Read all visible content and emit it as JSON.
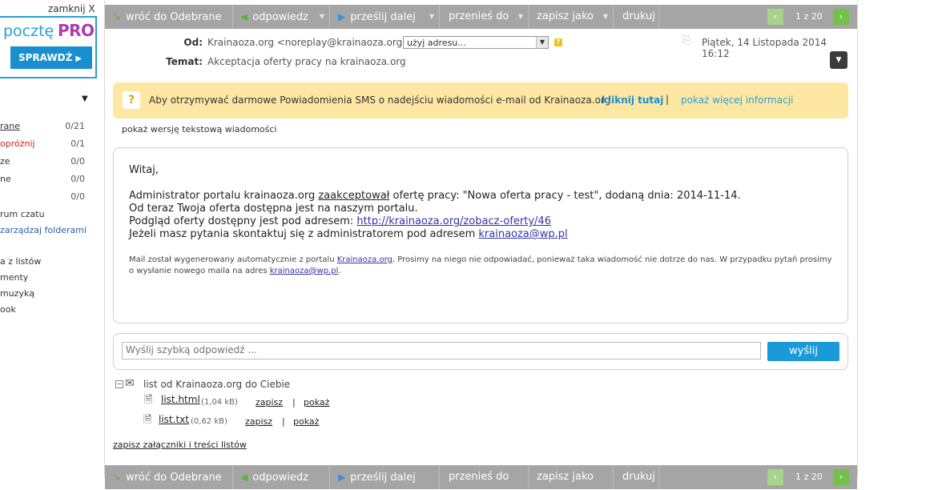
{
  "sidebar": {
    "promo": {
      "close": "zamknij X",
      "text": "pocztę",
      "pro": "PRO",
      "button": "SPRAWDŹ"
    },
    "folders": [
      {
        "name": "rane",
        "count": "0/21"
      },
      {
        "name": "opróżnij",
        "count": "0/1"
      },
      {
        "name": "ze",
        "count": "0/0"
      },
      {
        "name": "ne",
        "count": "0/0"
      },
      {
        "name": "",
        "count": "0/0"
      }
    ],
    "links": [
      "rum czatu",
      "zarządzaj folderami",
      "a z listów",
      "menty",
      "muzyką",
      "ook"
    ]
  },
  "toolbar": {
    "back": "wróć do Odebrane",
    "reply": "odpowiedz",
    "forward": "prześlij dalej",
    "move": "przenieś do",
    "save_as": "zapisz jako",
    "print": "drukuj",
    "pager": "1 z 20",
    "prev": "‹",
    "next": "›"
  },
  "header": {
    "from_label": "Od:",
    "from_value": "Krainaoza.org <noreplay@krainaoza.org>",
    "use_address": "użyj adresu...",
    "subject_label": "Temat:",
    "subject_value": "Akceptacja oferty pracy na krainaoza.org",
    "date": "Piątek, 14 Listopada 2014 16:12"
  },
  "sms_banner": {
    "text": "Aby otrzymywać darmowe Powiadomienia SMS o nadejściu wiadomości e-mail od Krainaoza.org",
    "click_here": "kliknij tutaj",
    "separator": "|",
    "more_info": "pokaż więcej informacji"
  },
  "text_version": "pokaż wersję tekstową wiadomości",
  "message": {
    "greeting": "Witaj,",
    "line1_pre": "Administrator portalu krainaoza.org ",
    "line1_link": "zaakceptował",
    "line1_post": " ofertę pracy: \"Nowa oferta pracy - test\", dodaną dnia: 2014-11-14.",
    "line2": "Od teraz Twoja oferta dostępna jest na naszym portalu.",
    "line3_pre": "Podgląd oferty dostępny jest pod adresem: ",
    "line3_link": "http://krainaoza.org/zobacz-oferty/46",
    "line4_pre": "Jeżeli masz pytania skontaktuj się z administratorem pod adresem ",
    "line4_link": "krainaoza@wp.pl",
    "footer_pre": "Mail został wygenerowany automatycznie z portalu ",
    "footer_link1": "Krainaoza.org",
    "footer_mid": ". Prosimy na niego nie odpowiadać, ponieważ taka wiadomość nie dotrze do nas. W przypadku pytań prosimy o wysłanie nowego maila na adres ",
    "footer_link2": "krainaoza@wp.pl",
    "footer_end": "."
  },
  "quick_reply": {
    "placeholder": "Wyślij szybką odpowiedź ...",
    "send": "wyślij"
  },
  "attachments": {
    "tree_label": "list od Krainaoza.org do Ciebie",
    "files": [
      {
        "name": "list.html",
        "size": "(1,04 kB)",
        "save": "zapisz",
        "sep": "|",
        "show": "pokaż"
      },
      {
        "name": "list.txt",
        "size": "(0,62 kB)",
        "save": "zapisz",
        "sep": "|",
        "show": "pokaż"
      }
    ],
    "save_all": "zapisz załączniki i treści listów"
  }
}
